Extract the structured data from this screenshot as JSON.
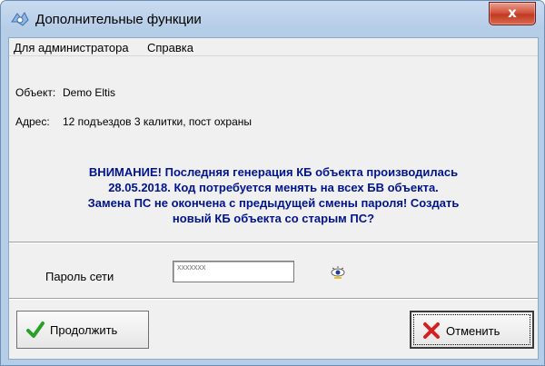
{
  "window": {
    "title": "Дополнительные функции",
    "close_glyph": "x",
    "icon": "app-icon"
  },
  "menu": {
    "items": [
      "Для администратора",
      "Справка"
    ]
  },
  "info": {
    "object_label": "Объект:",
    "object_value": "Demo Eltis",
    "address_label": "Адрес:",
    "address_value": "12 подъездов 3 калитки, пост охраны"
  },
  "warning": {
    "lines": [
      "ВНИМАНИЕ! Последняя генерация КБ объекта производилась",
      "28.05.2018. Код потребуется менять на всех БВ объекта.",
      "Замена ПС не окончена с предыдущей смены пароля! Создать",
      "новый КБ объекта со старым ПС?"
    ],
    "color": "#00148c"
  },
  "password": {
    "label": "Пароль сети",
    "value": "xxxxxxx",
    "toggle_icon": "show-password-icon"
  },
  "buttons": {
    "continue_label": "Продолжить",
    "continue_icon": "checkmark-icon",
    "cancel_label": "Отменить",
    "cancel_icon": "cross-icon"
  }
}
